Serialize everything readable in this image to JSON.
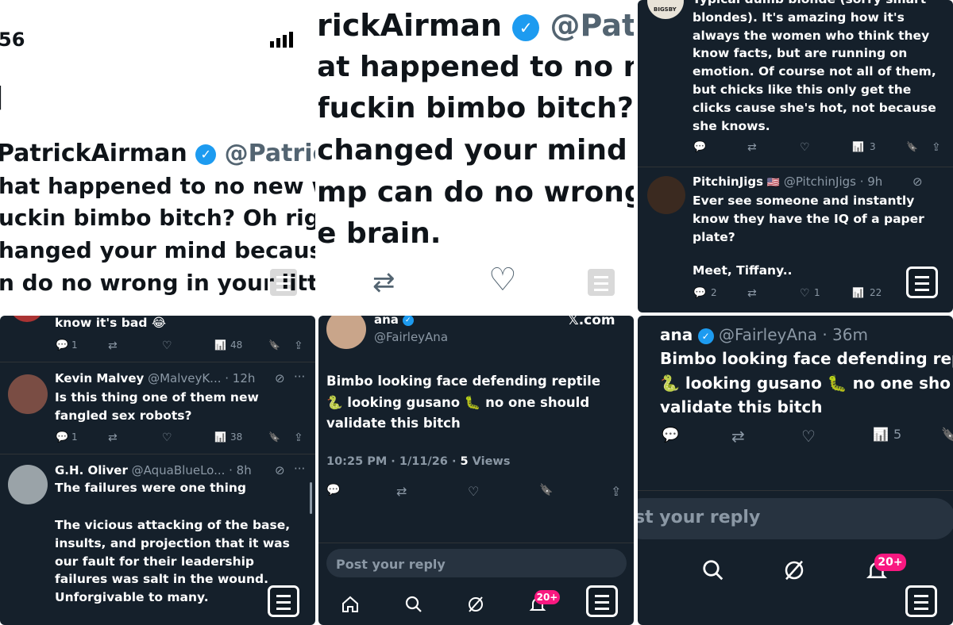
{
  "p1": {
    "time": "56",
    "author_name": "PatrickAirman",
    "author_handle": "@PatrickAi",
    "text_lines": [
      "hat happened to no new wa",
      "uckin bimbo bitch? Oh right",
      "hanged your mind because",
      "n do no wrong in your little"
    ]
  },
  "p2": {
    "author_name": "rickAirman",
    "author_handle": "@Pat...",
    "text_lines": [
      "at happened to no ne",
      " fuckin bimbo bitch?",
      "changed your mind l",
      "mp can do no wrong i",
      "e brain."
    ]
  },
  "p3": {
    "avatar_label": "BIGSBY",
    "top_text": "Typical dumb blonde (sorry smart blondes). It's amazing how it's always the women who think they know facts, but are running on emotion. Of course not all of them, but chicks like this only get the clicks cause she's hot, not because she knows.",
    "top_views": "3",
    "reply2": {
      "name": "PitchinJigs",
      "flag": "🇺🇸",
      "handle": "@PitchinJigs · 9h",
      "text": "Ever see someone and instantly know they have the IQ of a paper plate?",
      "text2": "Meet, Tiffany..",
      "replies": "2",
      "likes": "1",
      "views": "22"
    }
  },
  "p4": {
    "top_text": "know it's bad 😂",
    "top_replies": "1",
    "top_views": "48",
    "reply1": {
      "name": "Kevin Malvey",
      "handle": "@MalveyK... · 12h",
      "text": "Is this thing one of them new fangled sex robots?",
      "replies": "1",
      "views": "38"
    },
    "reply2": {
      "name": "G.H. Oliver",
      "handle": "@AquaBlueLo... · 8h",
      "text": "The failures were one thing",
      "text2": "The vicious attacking of the base, insults, and projection that it was our fault for their leadership failures was salt in the wound. Unforgivable to many."
    }
  },
  "p5": {
    "name": "ana",
    "handle": "@FairleyAna",
    "watermark": "𝕏.com",
    "text": "Bimbo looking face defending reptile 🐍 looking gusano 🐛 no one should validate this bitch",
    "meta_time": "10:25 PM · 1/11/26 · ",
    "meta_views_num": "5",
    "meta_views_label": " Views",
    "reply_placeholder": "Post your reply",
    "notif_badge": "20+"
  },
  "p6": {
    "name": "ana",
    "handle": "@FairleyAna · 36m",
    "text_lines": [
      "Bimbo looking face defending rep",
      "🐍 looking gusano 🐛 no one sho",
      "validate this bitch"
    ],
    "views": "5",
    "reply_placeholder": "st your reply",
    "notif_badge": "20+"
  },
  "icons": {
    "verified": "✓",
    "reply": "💬",
    "retweet": "⇄",
    "like": "♡",
    "views": "📊",
    "bookmark": "🔖",
    "share": "⇪",
    "home": "⌂",
    "search": "⚲",
    "grok": "⊘",
    "bell": "🔔",
    "more": "···"
  },
  "colors": {
    "dark_bg": "#15202b",
    "accent": "#1d9bf0",
    "pink": "#f91880",
    "grey": "#8b98a5"
  }
}
